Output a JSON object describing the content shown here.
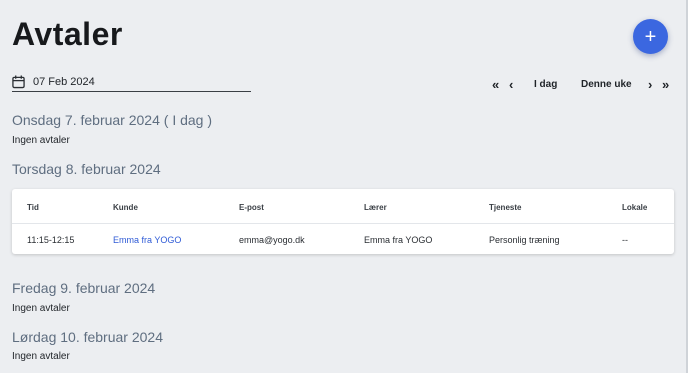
{
  "header": {
    "title": "Avtaler",
    "add_button_icon": "+"
  },
  "date_picker": {
    "value": "07 Feb 2024",
    "icon": "calendar-icon"
  },
  "navigation": {
    "prev_week": "«",
    "prev_day": "‹",
    "today": "I dag",
    "this_week": "Denne uke",
    "next_day": "›",
    "next_week": "»"
  },
  "days": [
    {
      "heading": "Onsdag 7. februar 2024 ( I dag )",
      "empty_text": "Ingen avtaler"
    },
    {
      "heading": "Torsdag 8. februar 2024"
    },
    {
      "heading": "Fredag 9. februar 2024",
      "empty_text": "Ingen avtaler"
    },
    {
      "heading": "Lørdag 10. februar 2024",
      "empty_text": "Ingen avtaler"
    }
  ],
  "table": {
    "columns": [
      "Tid",
      "Kunde",
      "E-post",
      "Lærer",
      "Tjeneste",
      "Lokale"
    ],
    "rows": [
      [
        "11:15-12:15",
        "Emma fra YOGO",
        "emma@yogo.dk",
        "Emma fra YOGO",
        "Personlig træning",
        "--"
      ]
    ]
  }
}
